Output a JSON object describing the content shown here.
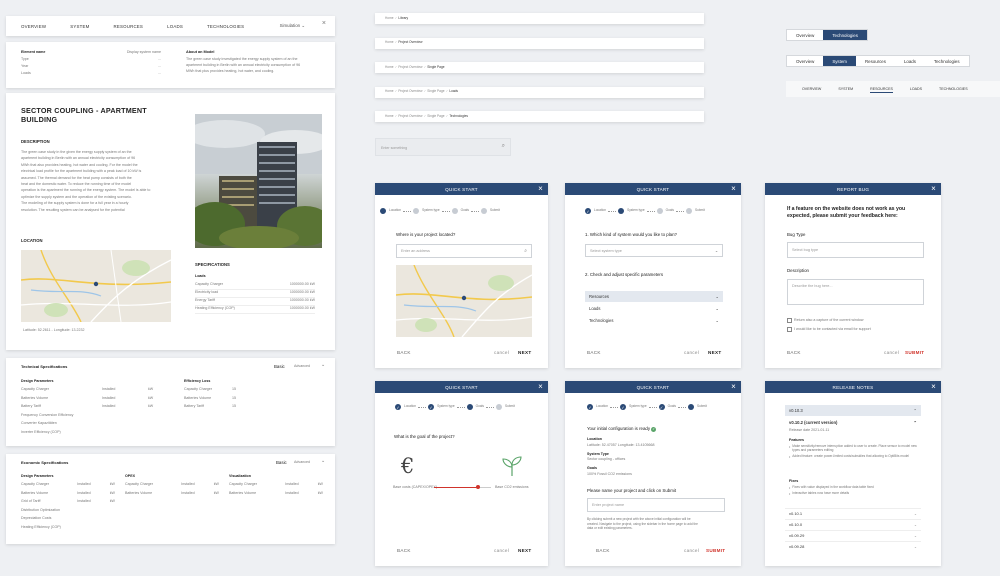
{
  "top_nav": {
    "items": [
      "OVERVIEW",
      "SYSTEM",
      "RESOURCES",
      "LOADS",
      "TECHNOLOGIES"
    ],
    "right_label": "Simulation"
  },
  "element_panel": {
    "rows": [
      [
        "Element name",
        "Display system name"
      ],
      [
        "Type",
        "..."
      ],
      [
        "Year",
        "..."
      ],
      [
        "Loads",
        "..."
      ]
    ],
    "about_title": "About an Model",
    "about_text": [
      "The green case study investigated the energy supply system of an the",
      "apartment building in Berlin with an annual electricity consumption of 96",
      "MWh that plus provides heating, hot water, and cooling."
    ]
  },
  "project": {
    "title": "SECTOR COUPLING - APARTMENT BUILDING",
    "description_label": "DESCRIPTION",
    "description": [
      "The green case study in the given the energy supply system of an the",
      "apartment building in Berlin with an annual electricity consumption of 96",
      "MWh that also provides heating, hot water and cooling. For the model the",
      "electrical load profile for the apartment building with a peak load of 10 kW is",
      "assumed. The thermal demand for the heat pump consists of both the",
      "heat and the domestic water. To reduce the running time of the model",
      "operation is the apartment the running of the energy system. The model is able to",
      "optimize the supply system and the operation of the existing scenario.",
      "The modeling of the supply system is done for a full year in a hourly",
      "resolution. The resulting system can be analysed for the potential"
    ],
    "location_label": "LOCATION",
    "coords": "Latitude: 52.2611 - Longitude: 13.2232",
    "specs_label": "SPECIFICATIONS",
    "specs_sub": "Loads",
    "specs": [
      [
        "Capacity Charger",
        "1000000.00 kW"
      ],
      [
        "Electricity load",
        "1000000.00 kW"
      ],
      [
        "Energy Tariff",
        "1000000.00 kW"
      ],
      [
        "Heating Efficiency (COP)",
        "1000000.00 kW"
      ]
    ]
  },
  "tech_specs": {
    "title": "Technical Specifications",
    "controls": [
      "Basic",
      "Advanced"
    ],
    "col1_head": "Design Parameters",
    "col1": [
      [
        "Capacity Charger",
        "Installed",
        "kW"
      ],
      [
        "Batteries Volume",
        "Installed",
        "kW"
      ],
      [
        "Battery Tariff",
        "Installed",
        "kW"
      ],
      [
        "Frequency Conversion Efficiency",
        "",
        ""
      ],
      [
        "Converter Kapazitäten",
        "",
        ""
      ],
      [
        "Inverter Efficiency (COP)",
        "",
        ""
      ]
    ],
    "col2_head": "Efficiency Loss",
    "col2": [
      [
        "Capacity Charger",
        "15"
      ],
      [
        "Batteries Volume",
        "15"
      ],
      [
        "Battery Tariff",
        "15"
      ]
    ]
  },
  "economic": {
    "title": "Economic Specifications",
    "controls": [
      "Basic",
      "Advanced"
    ],
    "cols": [
      {
        "head": "Design Parameters",
        "rows": [
          [
            "Capacity Charger",
            "Installed",
            "kW"
          ],
          [
            "Batteries Volume",
            "Installed",
            "kW"
          ],
          [
            "Grid of Tariff",
            "Installed",
            "kW"
          ],
          [
            "Distribution Optimization",
            "",
            ""
          ],
          [
            "Depreciation Costs",
            "",
            ""
          ],
          [
            "Heating Efficiency (COP)",
            "",
            ""
          ]
        ]
      },
      {
        "head": "OPEX",
        "rows": [
          [
            "Capacity Charger",
            "Installed",
            "kW"
          ],
          [
            "Batteries Volume",
            "Installed",
            "kW"
          ]
        ]
      },
      {
        "head": "Visualization",
        "rows": [
          [
            "Capacity Charger",
            "Installed",
            "kW"
          ],
          [
            "Batteries Volume",
            "Installed",
            "kW"
          ]
        ]
      }
    ]
  },
  "breadcrumbs": [
    [
      "Home",
      "Library"
    ],
    [
      "Home",
      "Project Overview"
    ],
    [
      "Home",
      "Project Overview",
      "Single Page"
    ],
    [
      "Home",
      "Project Overview",
      "Single Page",
      "Loads"
    ],
    [
      "Home",
      "Project Overview",
      "Single Page",
      "Technologies"
    ]
  ],
  "search": {
    "placeholder": "Enter something"
  },
  "tabs_two": {
    "items": [
      "Overview",
      "Technologies"
    ],
    "active": 1
  },
  "tabs_five": {
    "items": [
      "Overview",
      "System",
      "Resources",
      "Loads",
      "Technologies"
    ],
    "active": 1
  },
  "tabs_line": {
    "items": [
      "OVERVIEW",
      "SYSTEM",
      "RESOURCES",
      "LOADS",
      "TECHNOLOGIES"
    ],
    "active": 2
  },
  "steps": [
    "Location",
    "System type",
    "Goals",
    "Submit"
  ],
  "qs_location": {
    "title": "QUICK START",
    "question": "Where is your project located?",
    "placeholder": "Enter an address",
    "back": "BACK",
    "cancel": "cancel",
    "next": "NEXT"
  },
  "qs_system": {
    "title": "QUICK START",
    "q1": "1. Which kind of system would you like to plan?",
    "placeholder": "Select system type",
    "q2": "2. Check and adjust specific parameters",
    "options": [
      "Resources",
      "Loads",
      "Technologies"
    ],
    "back": "BACK",
    "cancel": "cancel",
    "next": "NEXT"
  },
  "bug": {
    "title": "REPORT BUG",
    "intro": [
      "If a feature on the website does not work as you",
      "expected, please submit your feedback here:"
    ],
    "type_label": "Bug Type",
    "type_placeholder": "Select bug type",
    "desc_label": "Description",
    "desc_placeholder": "Describe the bug here...",
    "check1": "Return also a capture of the current window",
    "check2": "I would like to be contacted via email for support",
    "back": "BACK",
    "cancel": "cancel",
    "submit": "SUBMIT"
  },
  "qs_goal": {
    "title": "QUICK START",
    "question": "What is the goal of the project?",
    "left": "Base costs (CAPEX/OPEX)",
    "right": "Base CO2 emissions",
    "back": "BACK",
    "cancel": "cancel",
    "next": "NEXT",
    "euro": "€",
    "progress": 0.78
  },
  "qs_submit": {
    "title": "QUICK START",
    "ready": "Your initial configuration is ready",
    "fields": [
      [
        "Location",
        "Latitude: 52.47057 Longitude: 13.4105668"
      ],
      [
        "System Type",
        "Sector coupling - offices"
      ],
      [
        "Goals",
        "100% Fossil CO2 emissions"
      ]
    ],
    "name_prompt": "Please name your project and click on Submit",
    "name_placeholder": "Enter project name",
    "note": [
      "By clicking submit a new project with the above initial configuration will be",
      "created. Navigate to the project, using the sidebar in the home page to add the",
      "data or edit existing parameters."
    ],
    "back": "BACK",
    "cancel": "cancel",
    "submit": "SUBMIT"
  },
  "release": {
    "title": "RELEASE NOTES",
    "first": "v0.10.3",
    "current": "v0.10.2 (current version)",
    "date": "Release date 2021-01-11",
    "features_label": "Features",
    "features": [
      "Make sensitivity/remove interruption added to user to create. Place sensor to model new types and parameters editing",
      "Added feature: create power-limited costs/subsidies that allowing to OptiBits model"
    ],
    "fixes_label": "Fixes",
    "fixes": [
      "Fixes with value displayed in the workflow data table fixed",
      "Interactive tables now have more details"
    ],
    "older": [
      "v0.10.1",
      "v0.10.0",
      "v0.09.29",
      "v0.09.28"
    ]
  },
  "colors": {
    "primary": "#2b4a76",
    "danger": "#d0342c"
  }
}
